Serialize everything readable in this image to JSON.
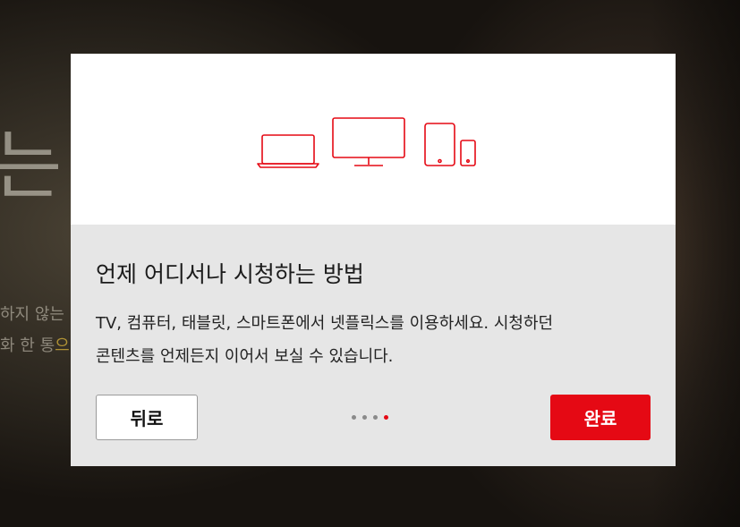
{
  "background": {
    "title_fragment": "는",
    "line1": "하지 않는",
    "line2_prefix": "화 한 통",
    "line2_highlight": "으"
  },
  "modal": {
    "heading": "언제 어디서나 시청하는 방법",
    "description_line1": "TV, 컴퓨터, 태블릿, 스마트폰에서 넷플릭스를 이용하세요. 시청하던",
    "description_line2": "콘텐츠를 언제든지 이어서 보실 수 있습니다.",
    "back_button": "뒤로",
    "done_button": "완료",
    "pagination": {
      "total": 4,
      "active": 4
    },
    "icons": [
      "laptop-icon",
      "monitor-icon",
      "tablet-icon",
      "phone-icon"
    ]
  },
  "colors": {
    "accent": "#e50914",
    "icon_stroke": "#e50914",
    "panel": "#e6e6e6"
  }
}
